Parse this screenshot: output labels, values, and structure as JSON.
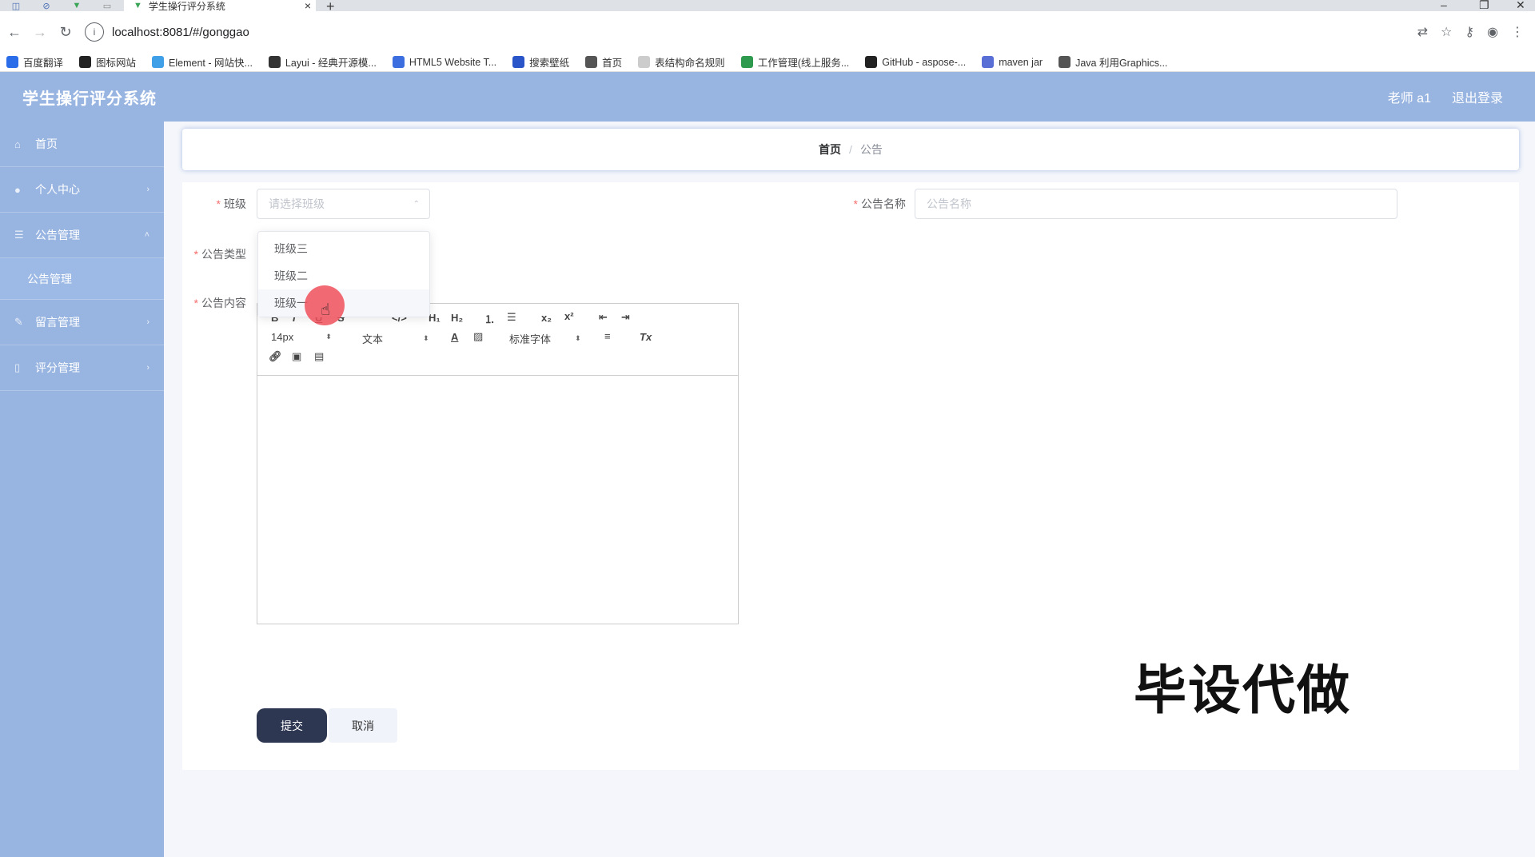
{
  "browser": {
    "tab_title": "学生操行评分系统",
    "url": "localhost:8081/#/gonggao",
    "bookmarks": [
      {
        "label": "百度翻译",
        "color": "#2b6de8"
      },
      {
        "label": "图标网站",
        "color": "#222222"
      },
      {
        "label": "Element - 网站快...",
        "color": "#3fa0e8"
      },
      {
        "label": "Layui - 经典开源模...",
        "color": "#333333"
      },
      {
        "label": "HTML5 Website T...",
        "color": "#3c6ee0"
      },
      {
        "label": "搜索壁纸",
        "color": "#2a55c8"
      },
      {
        "label": "首页",
        "color": "#555555"
      },
      {
        "label": "表结构命名规则",
        "color": "#cccccc"
      },
      {
        "label": "工作管理(线上服务...",
        "color": "#2e9a4e"
      },
      {
        "label": "GitHub - aspose-...",
        "color": "#222222"
      },
      {
        "label": "maven jar",
        "color": "#5a6fd6"
      },
      {
        "label": "Java 利用Graphics...",
        "color": "#555555"
      }
    ]
  },
  "header": {
    "title": "学生操行评分系统",
    "user": "老师 a1",
    "logout": "退出登录"
  },
  "sidebar": {
    "items": [
      {
        "label": "首页",
        "icon": "home-icon"
      },
      {
        "label": "个人中心",
        "icon": "user-icon"
      },
      {
        "label": "公告管理",
        "icon": "menu-icon"
      },
      {
        "label": "公告管理",
        "sub": true
      },
      {
        "label": "留言管理",
        "icon": "message-icon"
      },
      {
        "label": "评分管理",
        "icon": "score-icon"
      }
    ]
  },
  "breadcrumb": {
    "home": "首页",
    "separator": "/",
    "current": "公告"
  },
  "form": {
    "class_label": "班级",
    "class_placeholder": "请选择班级",
    "name_label": "公告名称",
    "name_placeholder": "公告名称",
    "type_label": "公告类型",
    "content_label": "公告内容",
    "submit": "提交",
    "cancel": "取消"
  },
  "dropdown": {
    "options": [
      "班级三",
      "班级二",
      "班级一"
    ],
    "hovered": "班级一"
  },
  "editor": {
    "font_size": "14px",
    "text_style": "文本",
    "font_family": "标准字体"
  },
  "watermark": "毕设代做"
}
